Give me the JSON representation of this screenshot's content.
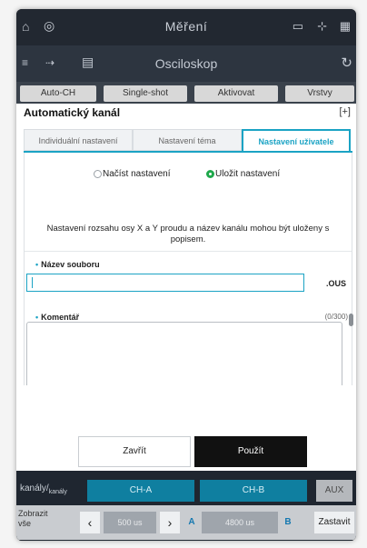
{
  "app": {
    "title": "Měření",
    "subtitle": "Osciloskop",
    "toolbar_buttons": [
      "Auto-CH",
      "Single-shot",
      "Aktivovat",
      "Vrstvy"
    ]
  },
  "dialog": {
    "title": "Automatický kanál",
    "tabs": [
      {
        "label": "Individuální nastavení",
        "active": false
      },
      {
        "label": "Nastavení téma",
        "active": false
      },
      {
        "label": "Nastavení uživatele",
        "active": true
      }
    ],
    "radio_load_label": "Načíst nastavení",
    "radio_save_label": "Uložit nastavení",
    "radio_selected": "save",
    "description": "Nastavení rozsahu osy X a Y proudu a název kanálu mohou být uloženy s popisem.",
    "filename_label": "Název souboru",
    "filename_value": "",
    "extension": ".OUS",
    "comment_label": "Komentář",
    "comment_counter": "(0/300)",
    "comment_value": "",
    "close_label": "Zavřít",
    "apply_label": "Použít"
  },
  "bottom_bar": {
    "channels_label": "kanály/",
    "channels_sub": "kanály",
    "ch_a": "CH-A",
    "ch_b": "CH-B",
    "aux": "AUX",
    "zobrazit_line1": "Zobrazit",
    "zobrazit_line2": "vše",
    "value_a": "500 us",
    "marker_a": "A",
    "value_b": "4800 us",
    "marker_b": "B",
    "stop_label": "Zastavit"
  },
  "colors": {
    "accent": "#1ba3c4",
    "radio_on": "#1fa84b",
    "apply_bg": "#111111"
  }
}
